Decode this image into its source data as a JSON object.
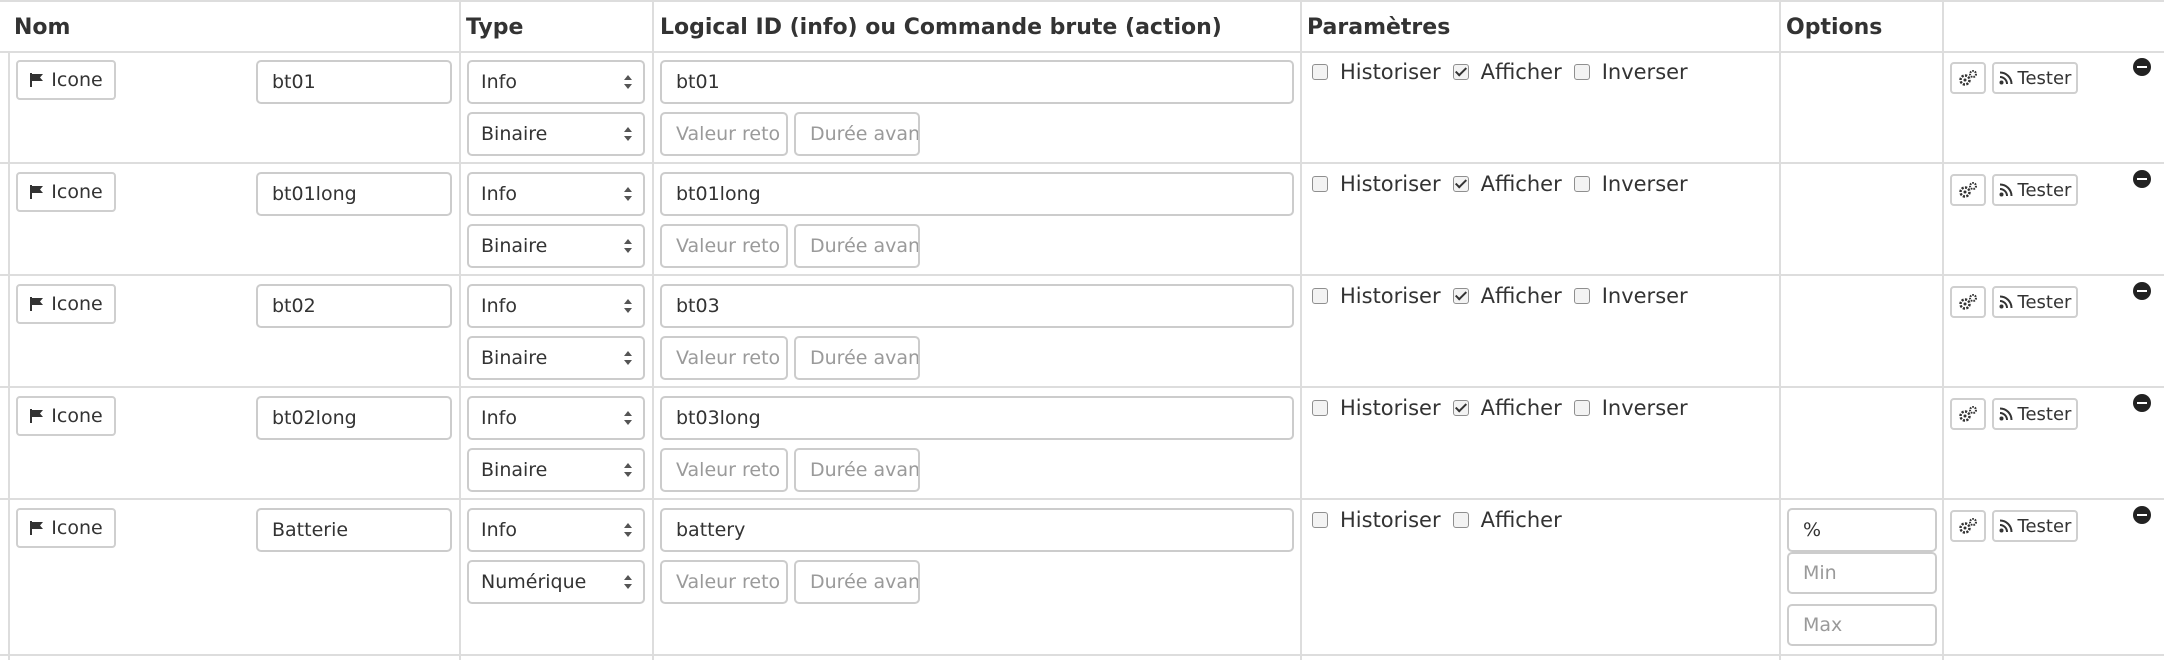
{
  "headers": {
    "nom": "Nom",
    "type": "Type",
    "logical_id": "Logical ID (info) ou Commande brute (action)",
    "parametres": "Paramètres",
    "options": "Options"
  },
  "rows": [
    {
      "icon_label": "Icone",
      "name": "bt01",
      "type": "Info",
      "subtype": "Binaire",
      "logical_id": "bt01",
      "valeur_retour_placeholder": "Valeur reto",
      "duree_placeholder": "Durée avan",
      "historiser": {
        "label": "Historiser",
        "checked": false
      },
      "afficher": {
        "label": "Afficher",
        "checked": true
      },
      "inverser": {
        "label": "Inverser",
        "checked": false
      },
      "tester_label": "Tester"
    },
    {
      "icon_label": "Icone",
      "name": "bt01long",
      "type": "Info",
      "subtype": "Binaire",
      "logical_id": "bt01long",
      "valeur_retour_placeholder": "Valeur reto",
      "duree_placeholder": "Durée avan",
      "historiser": {
        "label": "Historiser",
        "checked": false
      },
      "afficher": {
        "label": "Afficher",
        "checked": true
      },
      "inverser": {
        "label": "Inverser",
        "checked": false
      },
      "tester_label": "Tester"
    },
    {
      "icon_label": "Icone",
      "name": "bt02",
      "type": "Info",
      "subtype": "Binaire",
      "logical_id": "bt03",
      "valeur_retour_placeholder": "Valeur reto",
      "duree_placeholder": "Durée avan",
      "historiser": {
        "label": "Historiser",
        "checked": false
      },
      "afficher": {
        "label": "Afficher",
        "checked": true
      },
      "inverser": {
        "label": "Inverser",
        "checked": false
      },
      "tester_label": "Tester"
    },
    {
      "icon_label": "Icone",
      "name": "bt02long",
      "type": "Info",
      "subtype": "Binaire",
      "logical_id": "bt03long",
      "valeur_retour_placeholder": "Valeur reto",
      "duree_placeholder": "Durée avan",
      "historiser": {
        "label": "Historiser",
        "checked": false
      },
      "afficher": {
        "label": "Afficher",
        "checked": true
      },
      "inverser": {
        "label": "Inverser",
        "checked": false
      },
      "tester_label": "Tester"
    },
    {
      "icon_label": "Icone",
      "name": "Batterie",
      "type": "Info",
      "subtype": "Numérique",
      "logical_id": "battery",
      "valeur_retour_placeholder": "Valeur reto",
      "duree_placeholder": "Durée avan",
      "historiser": {
        "label": "Historiser",
        "checked": false
      },
      "afficher": {
        "label": "Afficher",
        "checked": false
      },
      "unit": "%",
      "min_placeholder": "Min",
      "max_placeholder": "Max",
      "tester_label": "Tester"
    }
  ]
}
